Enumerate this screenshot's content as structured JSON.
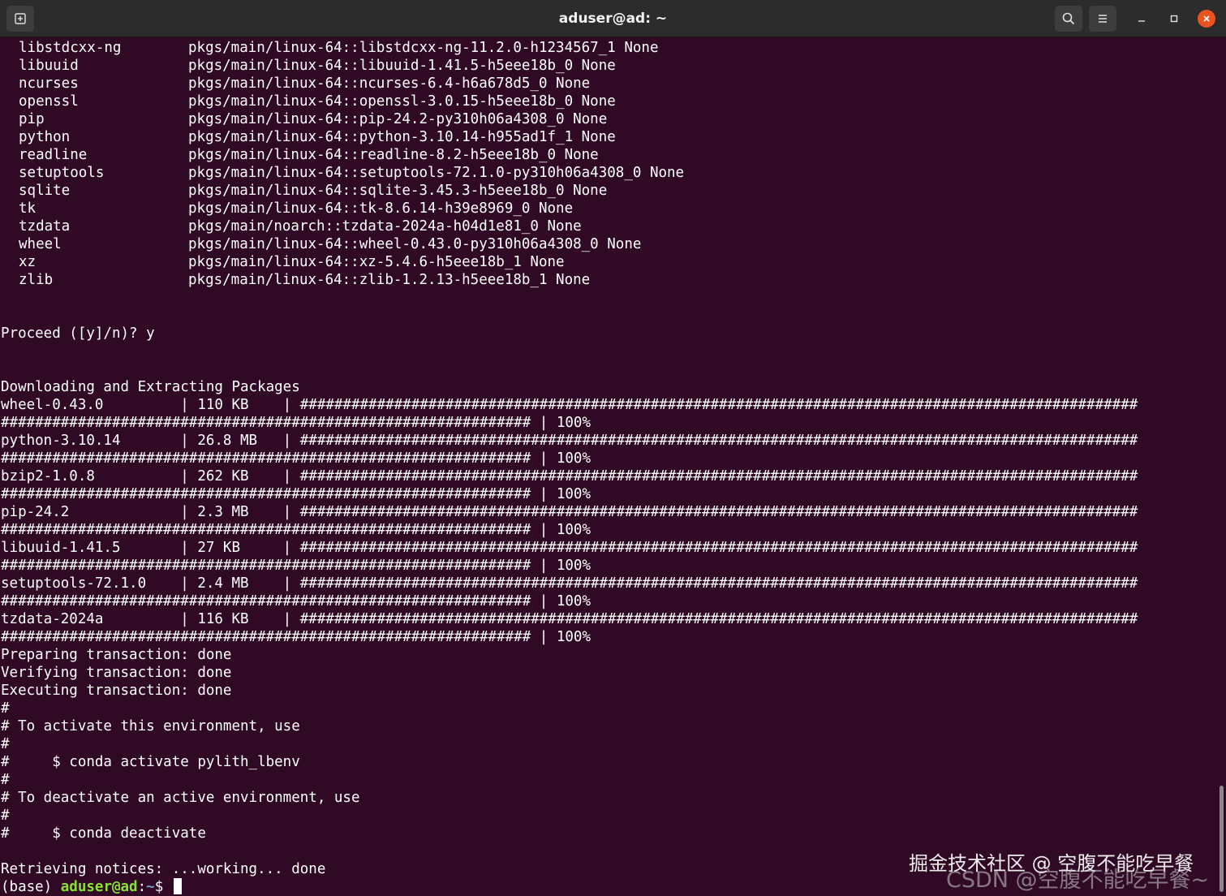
{
  "window": {
    "title": "aduser@ad: ~",
    "icons": {
      "new_tab": "new-tab-icon",
      "search": "search-icon",
      "menu": "hamburger-menu-icon",
      "minimize": "minimize-icon",
      "maximize": "maximize-icon",
      "close": "close-icon"
    },
    "colors": {
      "background": "#300a24",
      "titlebar": "#2c2c2c",
      "close": "#e95420",
      "prompt_user": "#8ae234",
      "prompt_path": "#729fcf"
    }
  },
  "terminal": {
    "packages": [
      {
        "name": "libstdcxx-ng",
        "spec": "pkgs/main/linux-64::libstdcxx-ng-11.2.0-h1234567_1 None"
      },
      {
        "name": "libuuid",
        "spec": "pkgs/main/linux-64::libuuid-1.41.5-h5eee18b_0 None"
      },
      {
        "name": "ncurses",
        "spec": "pkgs/main/linux-64::ncurses-6.4-h6a678d5_0 None"
      },
      {
        "name": "openssl",
        "spec": "pkgs/main/linux-64::openssl-3.0.15-h5eee18b_0 None"
      },
      {
        "name": "pip",
        "spec": "pkgs/main/linux-64::pip-24.2-py310h06a4308_0 None"
      },
      {
        "name": "python",
        "spec": "pkgs/main/linux-64::python-3.10.14-h955ad1f_1 None"
      },
      {
        "name": "readline",
        "spec": "pkgs/main/linux-64::readline-8.2-h5eee18b_0 None"
      },
      {
        "name": "setuptools",
        "spec": "pkgs/main/linux-64::setuptools-72.1.0-py310h06a4308_0 None"
      },
      {
        "name": "sqlite",
        "spec": "pkgs/main/linux-64::sqlite-3.45.3-h5eee18b_0 None"
      },
      {
        "name": "tk",
        "spec": "pkgs/main/linux-64::tk-8.6.14-h39e8969_0 None"
      },
      {
        "name": "tzdata",
        "spec": "pkgs/main/noarch::tzdata-2024a-h04d1e81_0 None"
      },
      {
        "name": "wheel",
        "spec": "pkgs/main/linux-64::wheel-0.43.0-py310h06a4308_0 None"
      },
      {
        "name": "xz",
        "spec": "pkgs/main/linux-64::xz-5.4.6-h5eee18b_1 None"
      },
      {
        "name": "zlib",
        "spec": "pkgs/main/linux-64::zlib-1.2.13-h5eee18b_1 None"
      }
    ],
    "proceed": "Proceed ([y]/n)? y",
    "downloading_header": "Downloading and Extracting Packages",
    "progress_bar_first": "##################################################################################################",
    "progress_bar_second": "##############################################################",
    "downloads": [
      {
        "name": "wheel-0.43.0",
        "size": "110 KB",
        "percent": "100%"
      },
      {
        "name": "python-3.10.14",
        "size": "26.8 MB",
        "percent": "100%"
      },
      {
        "name": "bzip2-1.0.8",
        "size": "262 KB",
        "percent": "100%"
      },
      {
        "name": "pip-24.2",
        "size": "2.3 MB",
        "percent": "100%"
      },
      {
        "name": "libuuid-1.41.5",
        "size": "27 KB",
        "percent": "100%"
      },
      {
        "name": "setuptools-72.1.0",
        "size": "2.4 MB",
        "percent": "100%"
      },
      {
        "name": "tzdata-2024a",
        "size": "116 KB",
        "percent": "100%"
      }
    ],
    "transaction": [
      "Preparing transaction: done",
      "Verifying transaction: done",
      "Executing transaction: done"
    ],
    "activation_notes": [
      "#",
      "# To activate this environment, use",
      "#",
      "#     $ conda activate pylith_lbenv",
      "#",
      "# To deactivate an active environment, use",
      "#",
      "#     $ conda deactivate"
    ],
    "notices": "Retrieving notices: ...working... done",
    "prompt": {
      "env": "(base) ",
      "user_host": "aduser@ad",
      "colon": ":",
      "path": "~",
      "symbol": "$ "
    }
  },
  "watermark": {
    "line1": "掘金技术社区 @ 空腹不能吃早餐",
    "line2": "CSDN @空腹不能吃早餐~"
  }
}
